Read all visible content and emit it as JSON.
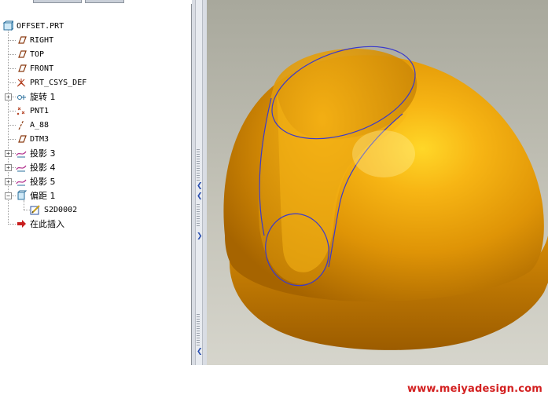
{
  "model_tree": {
    "root": {
      "label": "OFFSET.PRT",
      "icon": "part-icon"
    },
    "items": [
      {
        "label": "RIGHT",
        "icon": "datum-plane-icon",
        "expandable": false
      },
      {
        "label": "TOP",
        "icon": "datum-plane-icon",
        "expandable": false
      },
      {
        "label": "FRONT",
        "icon": "datum-plane-icon",
        "expandable": false
      },
      {
        "label": "PRT_CSYS_DEF",
        "icon": "csys-icon",
        "expandable": false
      },
      {
        "label": "旋转 1",
        "icon": "revolve-icon",
        "expandable": true
      },
      {
        "label": "PNT1",
        "icon": "datum-point-icon",
        "expandable": false
      },
      {
        "label": "A_88",
        "icon": "datum-axis-icon",
        "expandable": false
      },
      {
        "label": "DTM3",
        "icon": "datum-plane-icon",
        "expandable": false
      },
      {
        "label": "投影 3",
        "icon": "projected-curve-icon",
        "expandable": true
      },
      {
        "label": "投影 4",
        "icon": "projected-curve-icon",
        "expandable": true
      },
      {
        "label": "投影 5",
        "icon": "projected-curve-icon",
        "expandable": true
      },
      {
        "label": "偏距 1",
        "icon": "offset-icon",
        "expandable": true,
        "expanded": true
      },
      {
        "label": "S2D0002",
        "icon": "sketch-icon",
        "expandable": false,
        "child": true
      },
      {
        "label": "在此插入",
        "icon": "insert-here-arrow-icon",
        "expandable": false
      }
    ]
  },
  "viewport": {
    "model_color": "#e8a20a",
    "highlight_color": "#ffd12a",
    "shadow_color": "#a76400",
    "curve_color": "#3a3acc",
    "background_top": "#a8a89c",
    "background_bottom": "#d6d5cc"
  },
  "watermark": {
    "text": "www.meiyadesign.com",
    "color": "#d32020"
  }
}
